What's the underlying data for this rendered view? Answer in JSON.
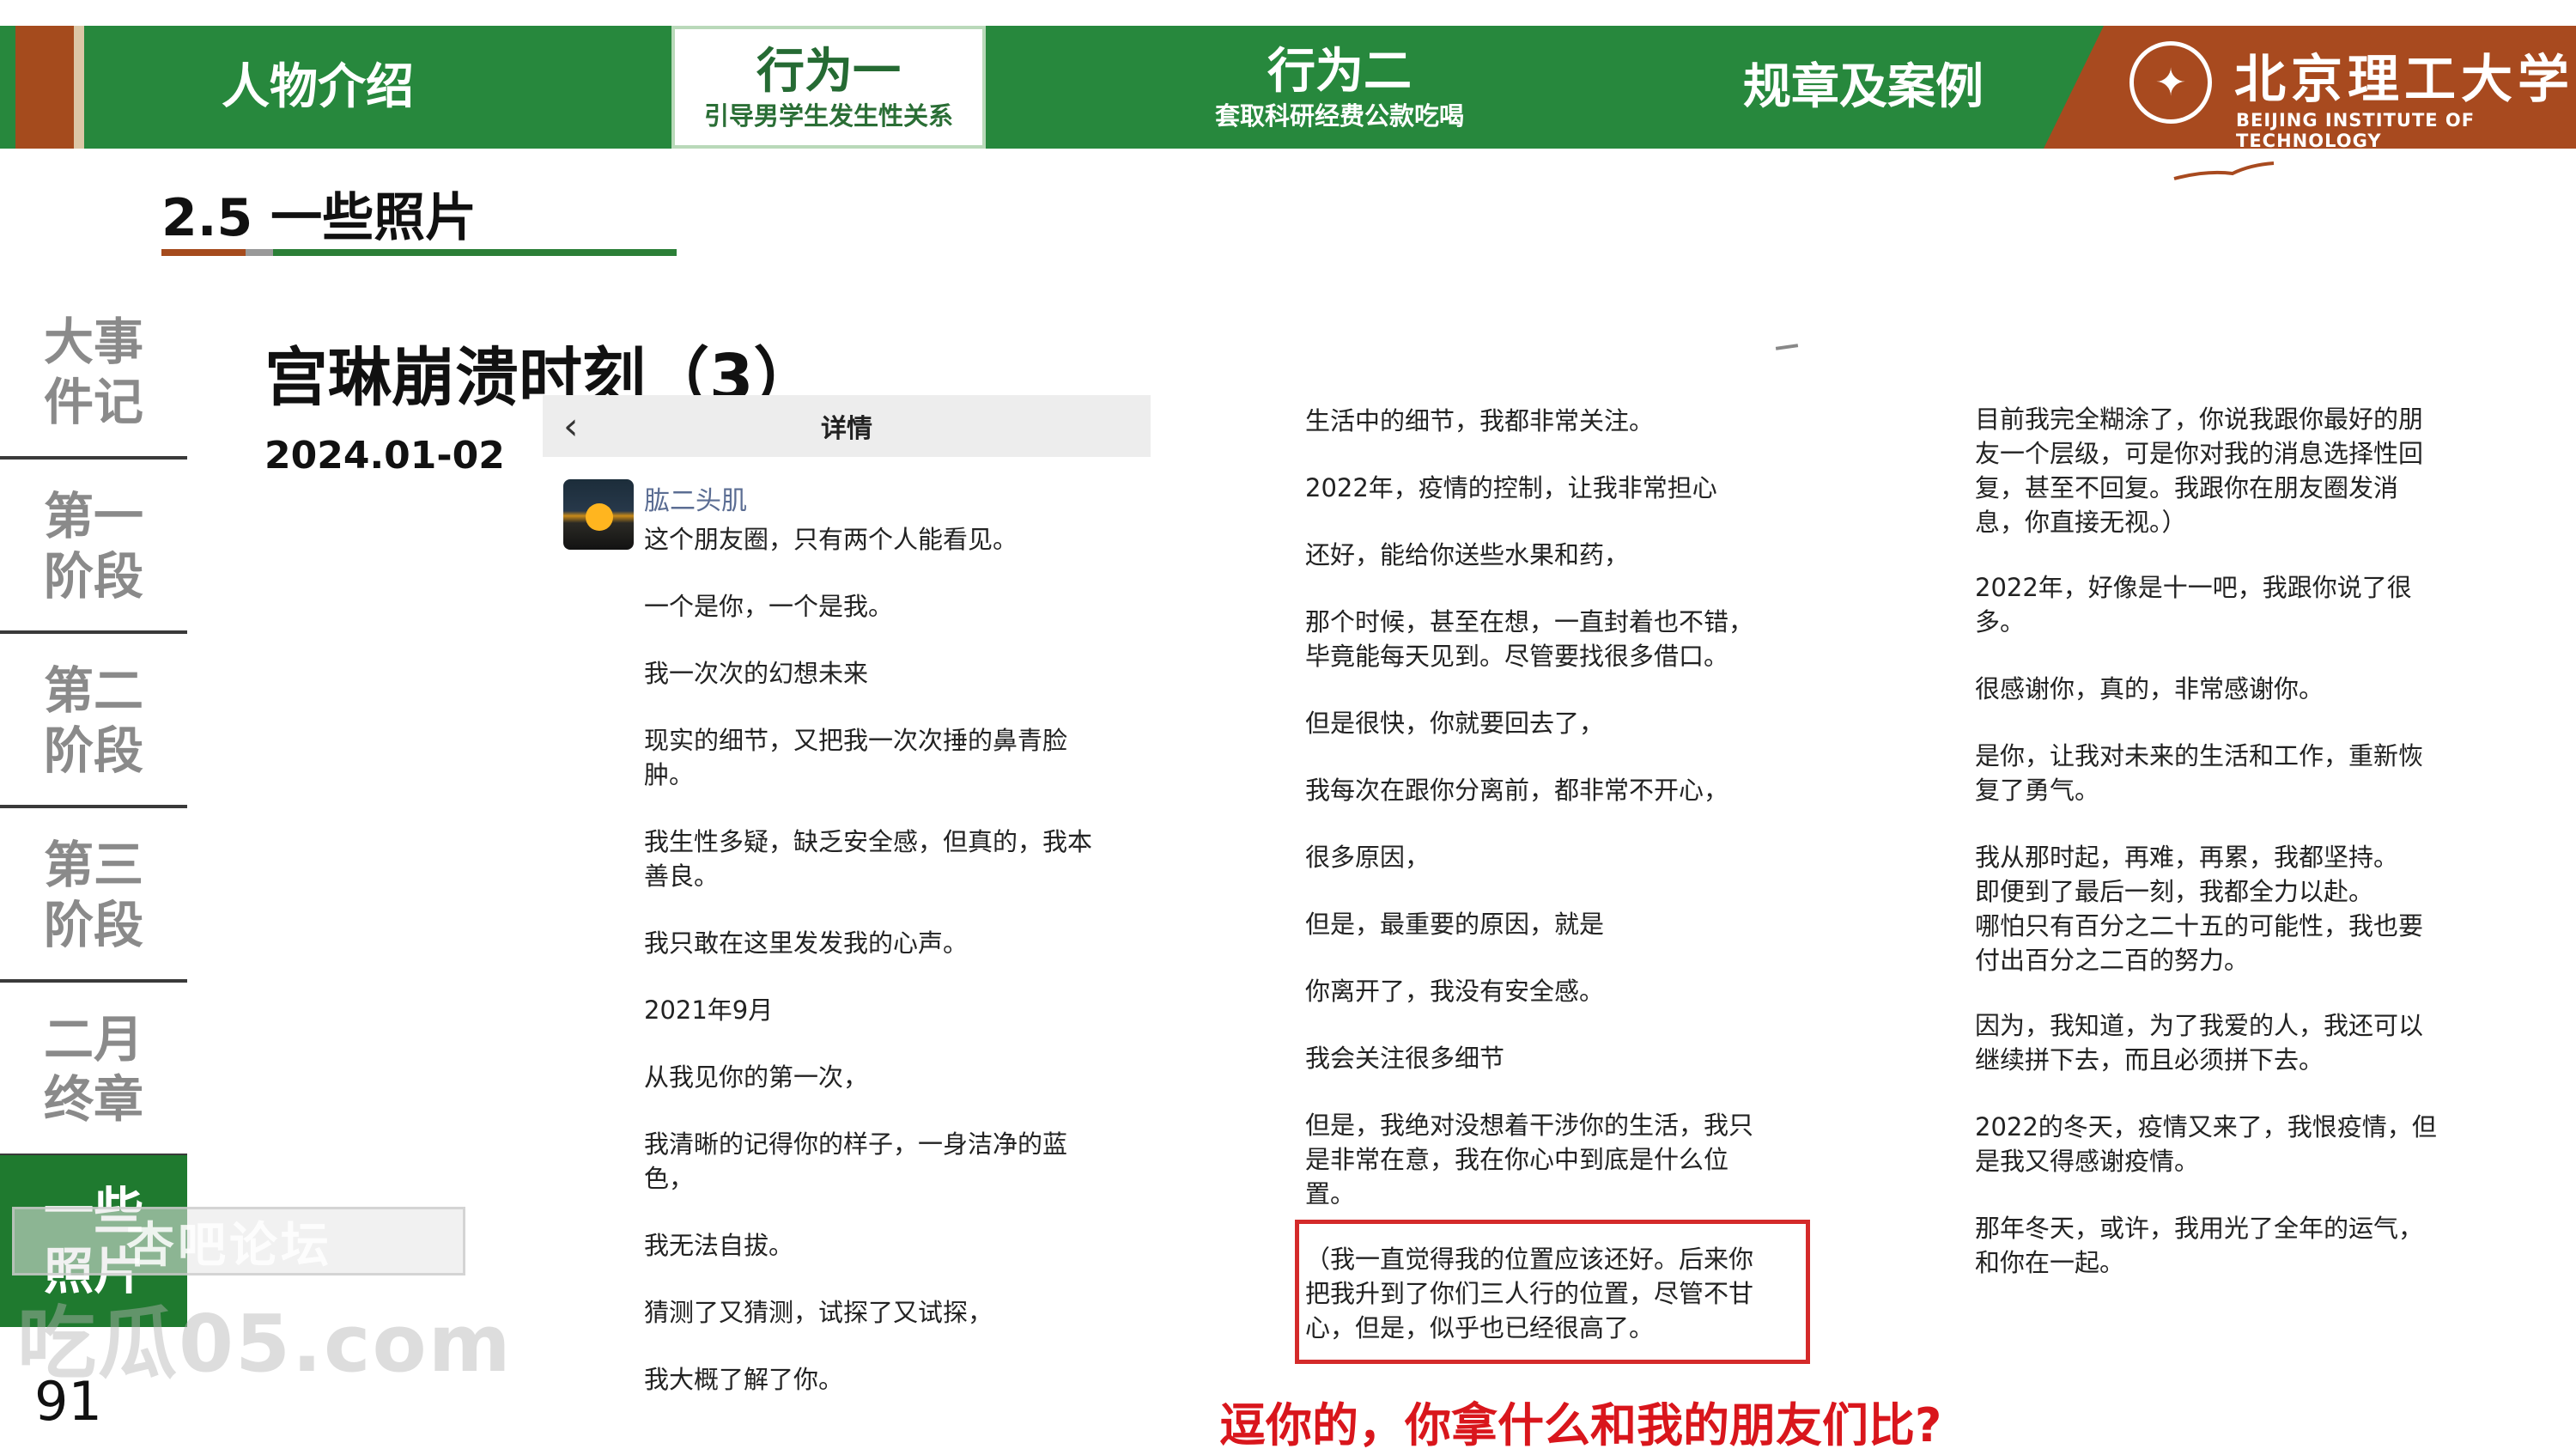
{
  "nav": {
    "tabs": [
      {
        "main": "人物介绍",
        "sub": ""
      },
      {
        "main": "行为一",
        "sub": "引导男学生发生性关系"
      },
      {
        "main": "行为二",
        "sub": "套取科研经费公款吃喝"
      },
      {
        "main": "规章及案例",
        "sub": ""
      }
    ],
    "active_tab": "行为一"
  },
  "brand": {
    "name_cn": "北京理工大学",
    "name_en": "BEIJING INSTITUTE OF TECHNOLOGY"
  },
  "section": {
    "title": "2.5 一些照片"
  },
  "sidebar": {
    "items": [
      {
        "line1": "大事",
        "line2": "件记"
      },
      {
        "line1": "第一",
        "line2": "阶段"
      },
      {
        "line1": "第二",
        "line2": "阶段"
      },
      {
        "line1": "第三",
        "line2": "阶段"
      },
      {
        "line1": "二月",
        "line2": "终章"
      },
      {
        "line1": "一些",
        "line2": "照片"
      }
    ],
    "active_item": "一些照片"
  },
  "page_number": "91",
  "watermark": {
    "forum": "杏吧论坛",
    "site": "吃瓜05.com"
  },
  "slide": {
    "headline": "宫琳崩溃时刻（3）",
    "date": "2024.01-02"
  },
  "phone": {
    "back_icon": "chevron-left-icon",
    "header_title": "详情",
    "author": "肱二头肌"
  },
  "post": {
    "column1": [
      "这个朋友圈，只有两个人能看见。",
      "一个是你，一个是我。",
      "我一次次的幻想未来",
      "现实的细节，又把我一次次捶的鼻青脸\n肿。",
      "我生性多疑，缺乏安全感，但真的，我本\n善良。",
      "我只敢在这里发发我的心声。",
      "2021年9月",
      "从我见你的第一次，",
      "我清晰的记得你的样子，一身洁净的蓝\n色，",
      "我无法自拔。",
      "猜测了又猜测，试探了又试探，",
      "我大概了解了你。"
    ],
    "column2": [
      "生活中的细节，我都非常关注。",
      "2022年，疫情的控制，让我非常担心",
      "还好，能给你送些水果和药，",
      "那个时候，甚至在想，一直封着也不错，\n毕竟能每天见到。尽管要找很多借口。",
      "但是很快，你就要回去了，",
      "我每次在跟你分离前，都非常不开心，",
      "很多原因，",
      "但是，最重要的原因，就是",
      "你离开了，我没有安全感。",
      "我会关注很多细节",
      "但是，我绝对没想着干涉你的生活，我只\n是非常在意，我在你心中到底是什么位\n置。",
      "（我一直觉得我的位置应该还好。后来你\n把我升到了你们三人行的位置，尽管不甘\n心，但是，似乎也已经很高了。"
    ],
    "column3": [
      "目前我完全糊涂了，你说我跟你最好的朋\n友一个层级，可是你对我的消息选择性回\n复，甚至不回复。我跟你在朋友圈发消\n息，你直接无视。）",
      "2022年，好像是十一吧，我跟你说了很\n多。",
      "很感谢你，真的，非常感谢你。",
      "是你，让我对未来的生活和工作，重新恢\n复了勇气。",
      "我从那时起，再难，再累，我都坚持。\n即便到了最后一刻，我都全力以赴。\n哪怕只有百分之二十五的可能性，我也要\n付出百分之二百的努力。",
      "因为，我知道，为了我爱的人，我还可以\n继续拼下去，而且必须拼下去。",
      "2022的冬天，疫情又来了，我恨疫情，但\n是我又得感谢疫情。",
      "那年冬天，或许，我用光了全年的运气，\n和你在一起。"
    ]
  },
  "annotation": {
    "caption": "逗你的，你拿什么和我的朋友们比?"
  },
  "colors": {
    "nav_green": "#27883d",
    "brand_brown": "#a84a1f",
    "sidebar_active": "#1f7a2f",
    "highlight_red": "#d42a2a",
    "caption_red": "#d9161c",
    "author_blue": "#5b6d93"
  }
}
